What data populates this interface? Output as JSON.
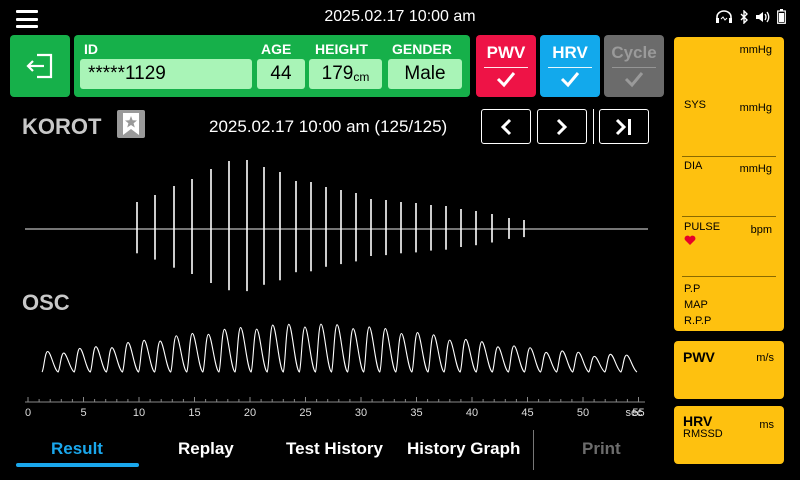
{
  "header": {
    "datetime": "2025.02.17  10:00 am",
    "status_icons": [
      "headset-icon",
      "bluetooth-icon",
      "volume-icon",
      "battery-icon"
    ]
  },
  "patient": {
    "id_label": "ID",
    "id_value": "*****1129",
    "age_label": "AGE",
    "age_value": "44",
    "height_label": "HEIGHT",
    "height_value": "179",
    "height_unit": "cm",
    "gender_label": "GENDER",
    "gender_value": "Male"
  },
  "toggles": {
    "pwv": {
      "label": "PWV",
      "color": "#ee1346",
      "enabled": true
    },
    "hrv": {
      "label": "HRV",
      "color": "#12a9ec",
      "enabled": true
    },
    "cycle": {
      "label": "Cycle",
      "color": "#6b6b6b",
      "enabled": false
    }
  },
  "korot": {
    "title": "KOROT",
    "record_info": "2025.02.17 10:00 am (125/125)"
  },
  "osc": {
    "title": "OSC"
  },
  "axis": {
    "ticks": [
      "0",
      "5",
      "10",
      "15",
      "20",
      "25",
      "30",
      "35",
      "40",
      "45",
      "50",
      "55"
    ],
    "unit": "sec"
  },
  "tabs": {
    "result": "Result",
    "replay": "Replay",
    "test_history": "Test History",
    "history_graph": "History Graph",
    "print": "Print"
  },
  "results": {
    "top_unit": "mmHg",
    "sys_label": "SYS",
    "sys_unit": "mmHg",
    "dia_label": "DIA",
    "dia_unit": "mmHg",
    "pulse_label": "PULSE",
    "pulse_unit": "bpm",
    "pp_label": "P.P",
    "map_label": "MAP",
    "rpp_label": "R.P.P",
    "pwv_label": "PWV",
    "pwv_unit": "m/s",
    "hrv_label": "HRV",
    "hrv_sub": "RMSSD",
    "hrv_unit": "ms"
  },
  "colors": {
    "green": "#16b04a",
    "light_green": "#a9f4b7",
    "yellow": "#fec10f",
    "accent_blue": "#1aa7ec"
  }
}
